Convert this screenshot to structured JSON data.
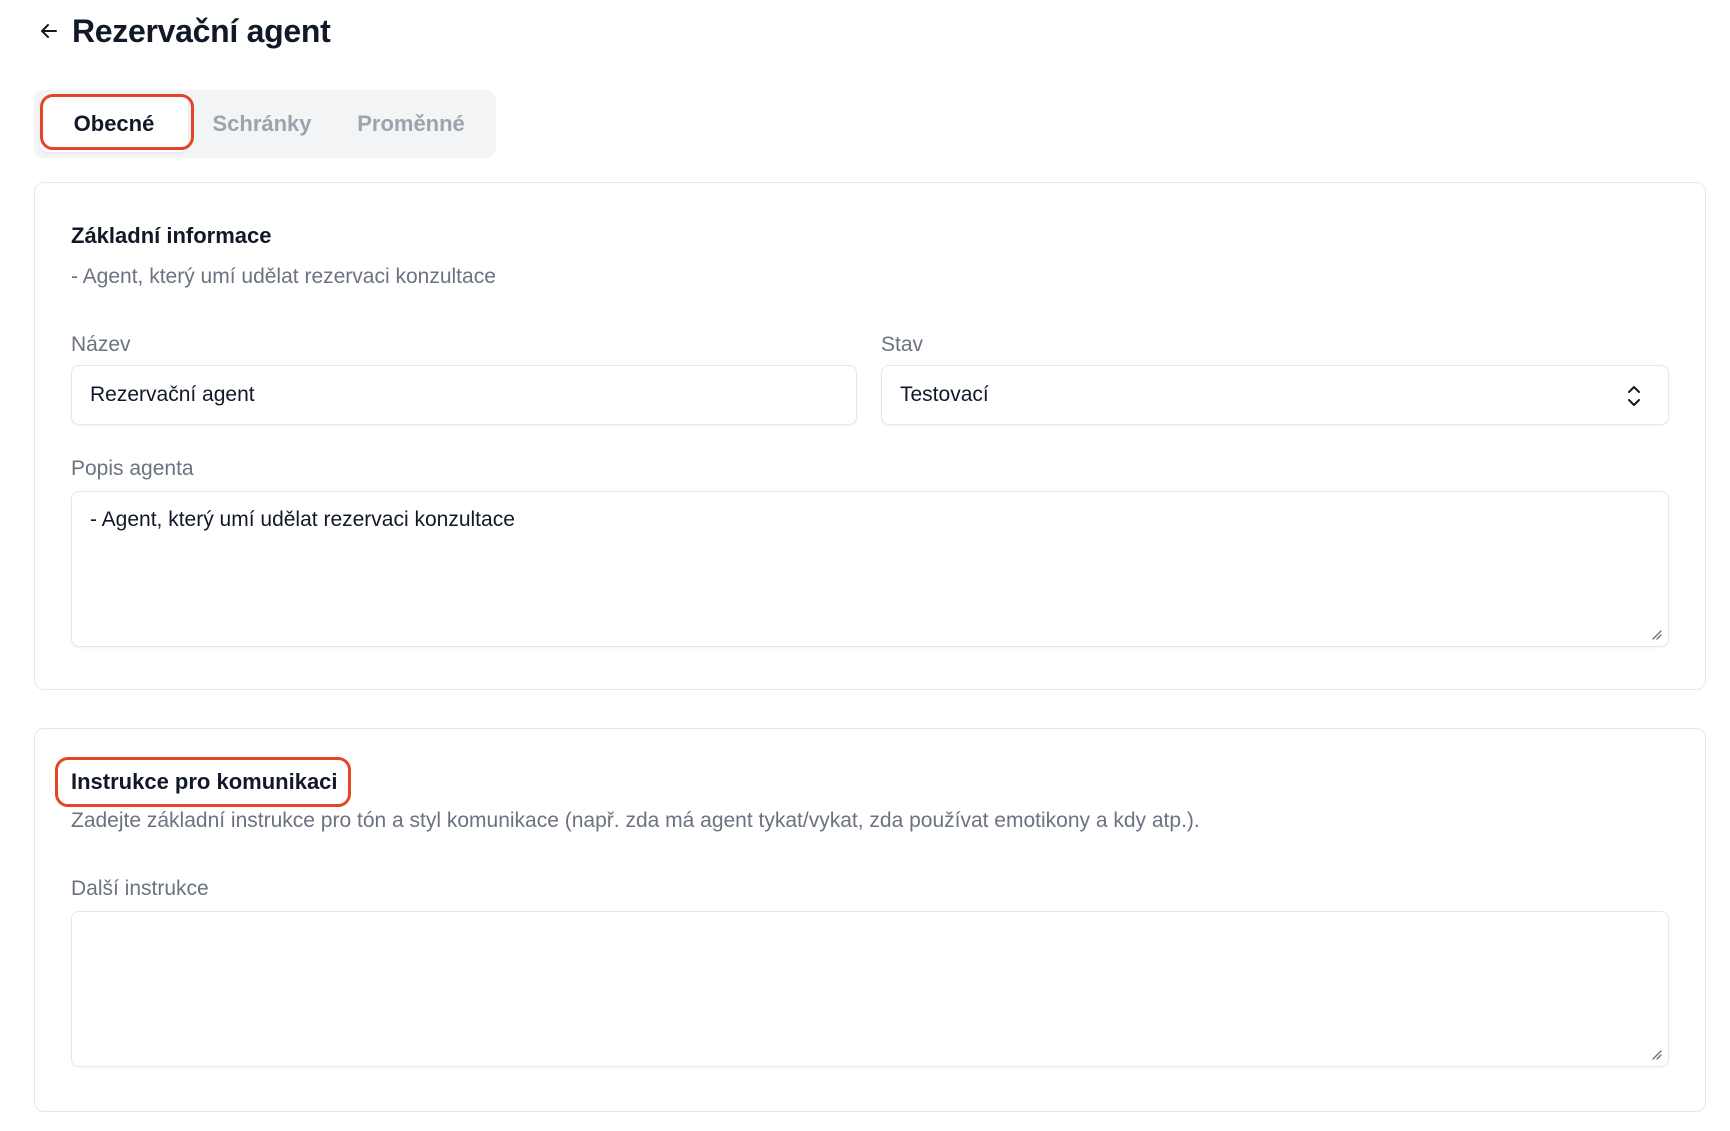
{
  "header": {
    "title": "Rezervační agent",
    "back_icon": "arrow-left-icon"
  },
  "tabs": [
    {
      "label": "Obecné",
      "active": true
    },
    {
      "label": "Schránky",
      "active": false
    },
    {
      "label": "Proměnné",
      "active": false
    }
  ],
  "basic_info": {
    "title": "Základní informace",
    "description": "- Agent, který umí udělat rezervaci konzultace",
    "name_label": "Název",
    "name_value": "Rezervační agent",
    "status_label": "Stav",
    "status_value": "Testovací",
    "agent_description_label": "Popis agenta",
    "agent_description_value": "- Agent, který umí udělat rezervaci konzultace"
  },
  "communication": {
    "title": "Instrukce pro komunikaci",
    "description": "Zadejte základní instrukce pro tón a styl komunikace (např. zda má agent tykat/vykat, zda používat emotikony a kdy atp.).",
    "extra_label": "Další instrukce",
    "extra_value": ""
  },
  "colors": {
    "highlight": "#e34526",
    "border": "#e5e7eb",
    "muted_text": "#6b7280"
  }
}
